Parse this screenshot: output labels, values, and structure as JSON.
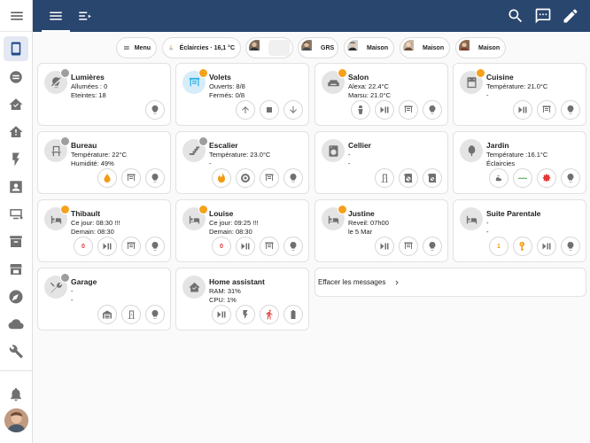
{
  "sidebar": {
    "menu_icon": "menu-icon",
    "items": [
      {
        "icon": "tablet-icon",
        "active": true
      },
      {
        "icon": "list-icon"
      },
      {
        "icon": "home-assistant-icon"
      },
      {
        "icon": "home-alert-icon"
      },
      {
        "icon": "flash-icon"
      },
      {
        "icon": "account-box-icon"
      },
      {
        "icon": "monitor-cog-icon"
      },
      {
        "icon": "archive-icon"
      },
      {
        "icon": "hacs-store-icon"
      },
      {
        "icon": "compass-icon"
      },
      {
        "icon": "cloud-icon"
      },
      {
        "icon": "wrench-icon"
      },
      {
        "icon": "bell-icon"
      }
    ]
  },
  "topbar": {
    "tabs": [
      "home-tab",
      "history-tab"
    ],
    "actions": [
      "search-icon",
      "assist-icon",
      "edit-icon"
    ]
  },
  "chips": [
    {
      "label": "Menu",
      "icon": "menu-icon"
    },
    {
      "label": "Éclaircies · 16,1 °C",
      "icon": "weather-icon"
    },
    {
      "label": "",
      "icon": "person-avatar"
    },
    {
      "label": "GRS",
      "icon": "person-avatar"
    },
    {
      "label": "Maison",
      "icon": "person-avatar"
    },
    {
      "label": "Maison",
      "icon": "person-avatar"
    },
    {
      "label": "Maison",
      "icon": "person-avatar"
    }
  ],
  "cards": [
    {
      "title": "Lumières",
      "l1": "Allumées : 0",
      "l2": "Eteintes: 18",
      "icon": "lightbulb-off-icon",
      "badge": "grey",
      "buttons": [
        {
          "icon": "lightbulb-icon"
        }
      ]
    },
    {
      "title": "Volets",
      "l1": "Ouverts: 8/8",
      "l2": "Fermés: 0/8",
      "icon": "blinds-icon",
      "badge": "orange",
      "blue": true,
      "buttons": [
        {
          "icon": "arrow-up-icon"
        },
        {
          "icon": "stop-icon"
        },
        {
          "icon": "arrow-down-icon"
        }
      ]
    },
    {
      "title": "Salon",
      "l1": "Alexa: 22.4°C",
      "l2": "Marsu: 21.0°C",
      "icon": "sofa-icon",
      "badge": "orange",
      "buttons": [
        {
          "icon": "spray-icon"
        },
        {
          "icon": "play-pause-icon"
        },
        {
          "icon": "blinds-icon"
        },
        {
          "icon": "lightbulb-icon"
        }
      ]
    },
    {
      "title": "Cuisine",
      "l1": "Température: 21.0°C",
      "l2": "-",
      "icon": "stove-icon",
      "badge": "orange",
      "buttons": [
        {
          "icon": "play-pause-icon"
        },
        {
          "icon": "blinds-icon"
        },
        {
          "icon": "lightbulb-icon"
        }
      ]
    },
    {
      "title": "Bureau",
      "l1": "Température: 22°C",
      "l2": "Humidité: 49%",
      "icon": "chair-icon",
      "badge": "grey",
      "buttons": [
        {
          "icon": "water-icon",
          "color": "orange"
        },
        {
          "icon": "blinds-icon"
        },
        {
          "icon": "lightbulb-icon"
        }
      ]
    },
    {
      "title": "Escalier",
      "l1": "Température: 23.0°C",
      "l2": "-",
      "icon": "stairs-icon",
      "badge": "grey",
      "buttons": [
        {
          "icon": "fire-icon",
          "color": "orange"
        },
        {
          "icon": "robot-vacuum-icon"
        },
        {
          "icon": "blinds-icon"
        },
        {
          "icon": "lightbulb-icon"
        }
      ]
    },
    {
      "title": "Cellier",
      "l1": "-",
      "l2": "-",
      "icon": "washing-machine-icon",
      "badge": "none",
      "buttons": [
        {
          "icon": "door-icon"
        },
        {
          "icon": "washing-off-icon"
        },
        {
          "icon": "dryer-off-icon"
        }
      ]
    },
    {
      "title": "Jardin",
      "l1": "Température :16.1°C",
      "l2": "Éclaircies",
      "icon": "tree-icon",
      "badge": "none",
      "buttons": [
        {
          "icon": "weather-icon"
        },
        {
          "icon": "pool-icon",
          "color": "green"
        },
        {
          "icon": "gear-icon",
          "color": "red"
        },
        {
          "icon": "lightbulb-icon"
        }
      ]
    },
    {
      "title": "Thibault",
      "l1": "Ce jour: 08:30 !!!",
      "l2": "Demain: 08:30",
      "icon": "bed-icon",
      "badge": "orange",
      "buttons": [
        {
          "text": "0",
          "color": "red-txt"
        },
        {
          "icon": "play-pause-icon"
        },
        {
          "icon": "blinds-icon"
        },
        {
          "icon": "lightbulb-icon"
        }
      ]
    },
    {
      "title": "Louise",
      "l1": "Ce jour: 09:25 !!!",
      "l2": "Demain: 08:30",
      "icon": "bed-icon",
      "badge": "orange",
      "buttons": [
        {
          "text": "0",
          "color": "red-txt"
        },
        {
          "icon": "play-pause-icon"
        },
        {
          "icon": "blinds-icon"
        },
        {
          "icon": "lightbulb-icon"
        }
      ]
    },
    {
      "title": "Justine",
      "l1": "Reveil:  07h00",
      "l2": "le 5 Mar",
      "icon": "bed-icon",
      "badge": "orange",
      "buttons": [
        {
          "icon": "play-pause-icon"
        },
        {
          "icon": "blinds-icon"
        },
        {
          "icon": "lightbulb-icon"
        }
      ]
    },
    {
      "title": "Suite Parentale",
      "l1": "-",
      "l2": "-",
      "icon": "bed-icon",
      "badge": "none",
      "buttons": [
        {
          "text": "1",
          "color": "org-txt"
        },
        {
          "icon": "key-icon",
          "color": "orange"
        },
        {
          "icon": "play-pause-icon"
        },
        {
          "icon": "lightbulb-icon"
        }
      ]
    },
    {
      "title": "Garage",
      "l1": "-",
      "l2": "-",
      "icon": "tools-icon",
      "badge": "grey",
      "buttons": [
        {
          "icon": "garage-icon"
        },
        {
          "icon": "door-icon"
        },
        {
          "icon": "lightbulb-icon"
        }
      ]
    },
    {
      "title": "Home assistant",
      "l1": "RAM: 31%",
      "l2": "CPU: 1%",
      "icon": "home-assistant-icon",
      "badge": "none",
      "buttons": [
        {
          "icon": "play-pause-icon"
        },
        {
          "icon": "flash-icon"
        },
        {
          "icon": "run-icon",
          "color": "red"
        },
        {
          "icon": "battery-icon"
        }
      ]
    }
  ],
  "messages": {
    "label": "Effacer les messages"
  },
  "colors": {
    "header": "#29466e",
    "accent": "#f5a11c",
    "active": "#1e4c8c"
  }
}
